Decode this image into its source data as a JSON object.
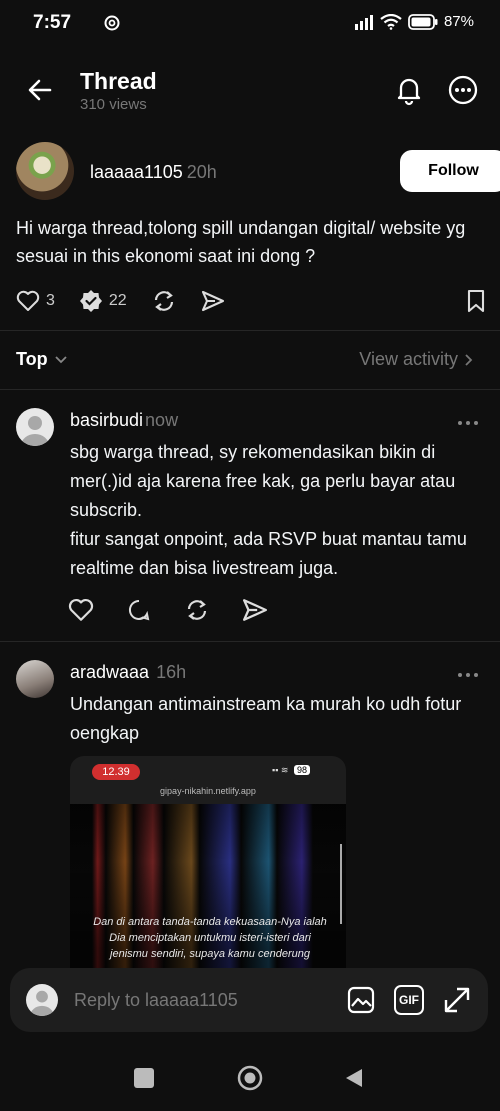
{
  "status": {
    "time": "7:57",
    "battery": "87%"
  },
  "header": {
    "title": "Thread",
    "views": "310 views"
  },
  "post": {
    "username": "laaaaa1105",
    "time": "20h",
    "follow_label": "Follow",
    "text": "Hi warga thread,tolong spill undangan digital/ website yg sesuai in this ekonomi saat ini dong ?",
    "likes": "3",
    "reposts": "22"
  },
  "sort": {
    "label": "Top",
    "view_activity": "View activity"
  },
  "replies": [
    {
      "username": "basirbudi",
      "time": "now",
      "text": "sbg warga thread, sy rekomendasikan bikin di mer(.)id aja karena free kak, ga perlu bayar atau subscrib.\nfitur sangat onpoint, ada RSVP buat mantau tamu realtime dan bisa livestream juga."
    },
    {
      "username": "aradwaaa",
      "time": "16h",
      "text": "Undangan antimainstream ka murah ko udh fotur oengkap",
      "media": {
        "time": "12.39",
        "battery": "98",
        "url": "gipay-nikahin.netlify.app",
        "verse": "Dan di antara tanda-tanda kekuasaan-Nya ialah Dia menciptakan untukmu isteri-isteri dari jenismu sendiri, supaya kamu cenderung"
      }
    }
  ],
  "reply_bar": {
    "placeholder": "Reply to laaaaa1105",
    "gif_label": "GIF"
  },
  "icons": [
    "back-arrow-icon",
    "bell-icon",
    "more-icon",
    "heart-icon",
    "repost-icon",
    "send-icon",
    "bookmark-icon",
    "chevron-down-icon",
    "chevron-right-icon",
    "comment-icon",
    "image-icon",
    "gif-icon",
    "expand-icon"
  ]
}
